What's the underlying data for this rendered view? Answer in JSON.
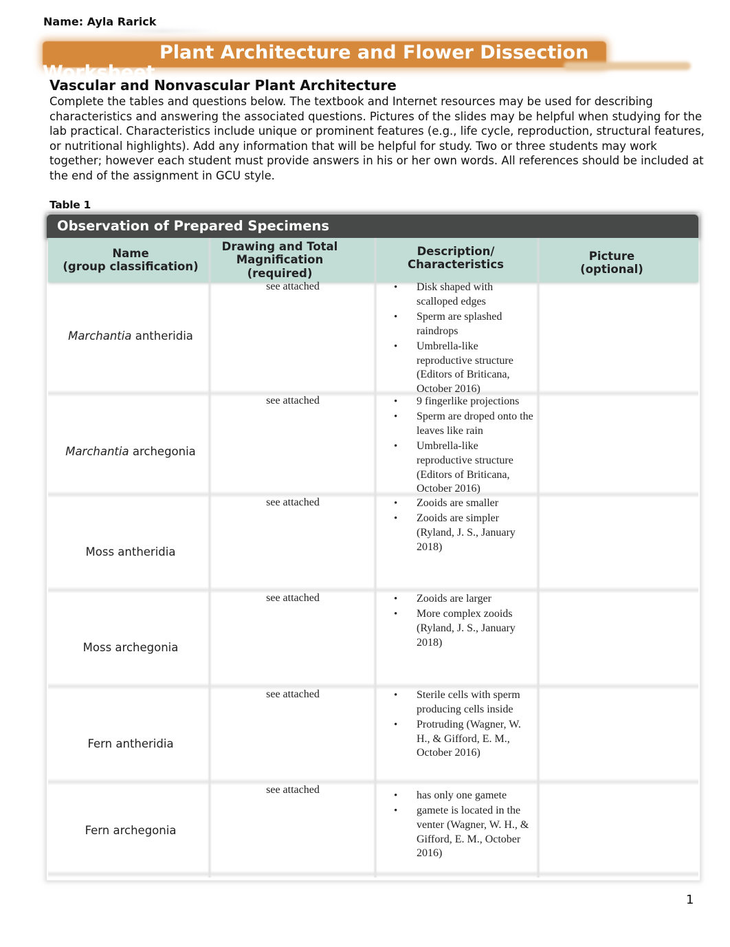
{
  "header": {
    "student_name": "Name: Ayla Rarick",
    "title_line1": "Plant Architecture and Flower Dissection",
    "title_line2": "Worksheet"
  },
  "section": {
    "heading": "Vascular and Nonvascular Plant Architecture",
    "intro": "Complete the tables and questions below. The textbook and Internet resources may be used for describing characteristics and answering the associated questions. Pictures of the slides may be helpful when studying for the lab practical. Characteristics include unique or prominent features (e.g., life cycle, reproduction, structural features, or nutritional highlights). Add any information that will be helpful for study. Two or three students may work together; however each student must provide answers in his or her own words. All references should be included at the end of the assignment in GCU style."
  },
  "table": {
    "label": "Table 1",
    "title": "Observation of Prepared Specimens",
    "columns": [
      {
        "line1": "Name",
        "line2": "(group classification)",
        "line3": ""
      },
      {
        "line1": "Drawing and Total",
        "line2": "Magnification",
        "line3": "(required)"
      },
      {
        "line1": "Description/",
        "line2": "Characteristics",
        "line3": ""
      },
      {
        "line1": "Picture",
        "line2": "(optional)",
        "line3": ""
      }
    ],
    "rows": [
      {
        "name_italic": "Marchantia",
        "name_rest": " antheridia",
        "drawing": "see attached",
        "characteristics": [
          "Disk shaped with scalloped edges",
          "Sperm are splashed raindrops",
          "Umbrella-like reproductive structure (Editors of Briticana, October 2016)"
        ],
        "picture": ""
      },
      {
        "name_italic": "Marchantia",
        "name_rest": " archegonia",
        "drawing": "see attached",
        "characteristics": [
          "9 fingerlike projections",
          "Sperm are droped onto the leaves like rain",
          "Umbrella-like reproductive structure (Editors of Briticana, October 2016)"
        ],
        "picture": ""
      },
      {
        "name_italic": "",
        "name_rest": "Moss antheridia",
        "drawing": "see attached",
        "characteristics": [
          "Zooids are smaller",
          "Zooids are simpler (Ryland, J. S., January 2018)"
        ],
        "picture": ""
      },
      {
        "name_italic": "",
        "name_rest": "Moss archegonia",
        "drawing": "see attached",
        "characteristics": [
          "Zooids are larger",
          "More complex zooids (Ryland, J. S., January 2018)"
        ],
        "picture": ""
      },
      {
        "name_italic": "",
        "name_rest": "Fern antheridia",
        "drawing": "see attached",
        "characteristics": [
          "Sterile cells with sperm producing cells inside",
          "Protruding (Wagner, W. H., & Gifford, E. M., October 2016)"
        ],
        "picture": ""
      },
      {
        "name_italic": "",
        "name_rest": "Fern archegonia",
        "drawing": "see attached",
        "characteristics": [
          "has only one gamete",
          "gamete is located in the venter (Wagner, W. H., & Gifford, E. M., October 2016)"
        ],
        "picture": ""
      }
    ]
  },
  "footer": {
    "page_number": "1"
  }
}
